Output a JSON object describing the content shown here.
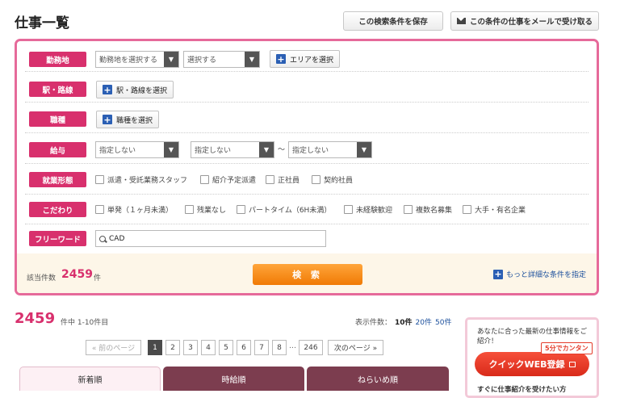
{
  "page_title": "仕事一覧",
  "top_buttons": {
    "save": "この検索条件を保存",
    "mail": "この条件の仕事をメールで受け取る"
  },
  "search": {
    "location": {
      "label": "勤務地",
      "select1": "勤務地を選択する",
      "select2": "選択する",
      "area_button": "エリアを選択"
    },
    "station": {
      "label": "駅・路線",
      "button": "駅・路線を選択"
    },
    "job": {
      "label": "職種",
      "button": "職種を選択"
    },
    "salary": {
      "label": "給与",
      "type": "指定しない",
      "min": "指定しない",
      "tilde": "～",
      "max": "指定しない"
    },
    "employment": {
      "label": "就業形態",
      "options": [
        "派遣・受託業務スタッフ",
        "紹介予定派遣",
        "正社員",
        "契約社員"
      ]
    },
    "preferences": {
      "label": "こだわり",
      "options": [
        "単発（１ヶ月未満）",
        "残業なし",
        "パートタイム（6H未満）",
        "未経験歓迎",
        "複数名募集",
        "大手・有名企業"
      ]
    },
    "freeword": {
      "label": "フリーワード",
      "value": "CAD"
    },
    "count_label": "該当件数",
    "count": "2459",
    "count_unit": "件",
    "search_button": "検 索",
    "more_link": "もっと詳細な条件を指定"
  },
  "results": {
    "total": "2459",
    "range": "件中 1-10件目",
    "per_page_label": "表示件数：",
    "per_page_current": "10件",
    "per_page_20": "20件",
    "per_page_50": "50件",
    "prev": "« 前のページ",
    "pages": [
      "1",
      "2",
      "3",
      "4",
      "5",
      "6",
      "7",
      "8"
    ],
    "ellipsis": "…",
    "last": "246",
    "next": "次のページ »",
    "tabs": [
      "新着順",
      "時給順",
      "ねらいめ順"
    ]
  },
  "sidebar": {
    "intro": "あなたに合った最新の仕事情報をご紹介！",
    "badge": "5分でカンタン",
    "button": "クイックWEB登録",
    "footer": "すぐに仕事紹介を受けたい方"
  }
}
